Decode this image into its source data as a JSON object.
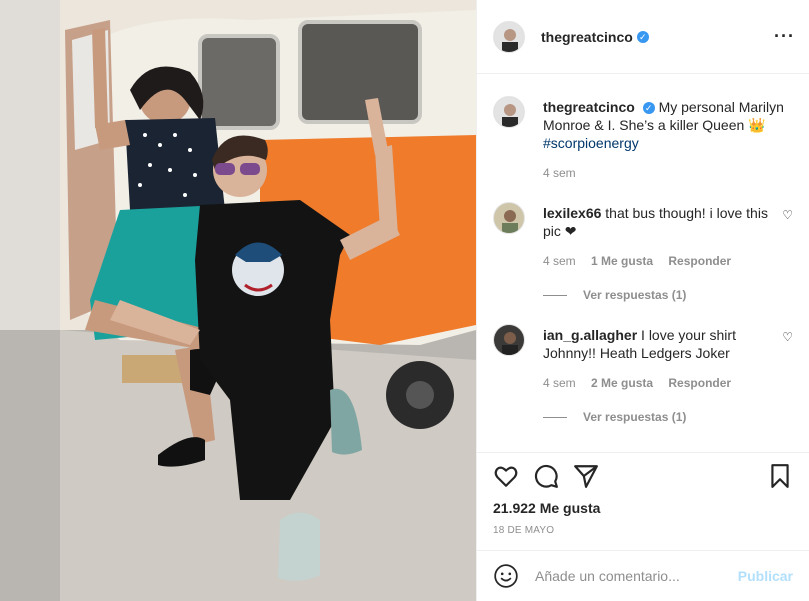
{
  "post": {
    "username": "thegreatcinco",
    "verified_icon": "verified-badge-icon",
    "more_icon": "more-options-icon",
    "caption": "My personal Marilyn Monroe & I. She’s a killer Queen 👑",
    "hashtag": "#scorpioenergy",
    "caption_time": "4 sem",
    "likes": "21.922 Me gusta",
    "date": "18 DE MAYO"
  },
  "comments": [
    {
      "username": "lexilex66",
      "text": "that bus though! i love this pic ❤",
      "time": "4 sem",
      "likes": "1 Me gusta",
      "reply_label": "Responder",
      "view_replies": "Ver respuestas (1)"
    },
    {
      "username": "ian_g.allagher",
      "text": "I love your shirt Johnny!! Heath Ledgers Joker",
      "time": "4 sem",
      "likes": "2 Me gusta",
      "reply_label": "Responder",
      "view_replies": "Ver respuestas (1)"
    }
  ],
  "actions": {
    "icons": [
      "heart-icon",
      "comment-icon",
      "share-icon",
      "bookmark-icon"
    ]
  },
  "add_comment": {
    "placeholder": "Añade un comentario...",
    "publish_label": "Publicar"
  },
  "colors": {
    "link": "#00376b",
    "muted": "#8e8e8e",
    "publish_disabled": "#b2dffc",
    "verified": "#3897f0"
  }
}
